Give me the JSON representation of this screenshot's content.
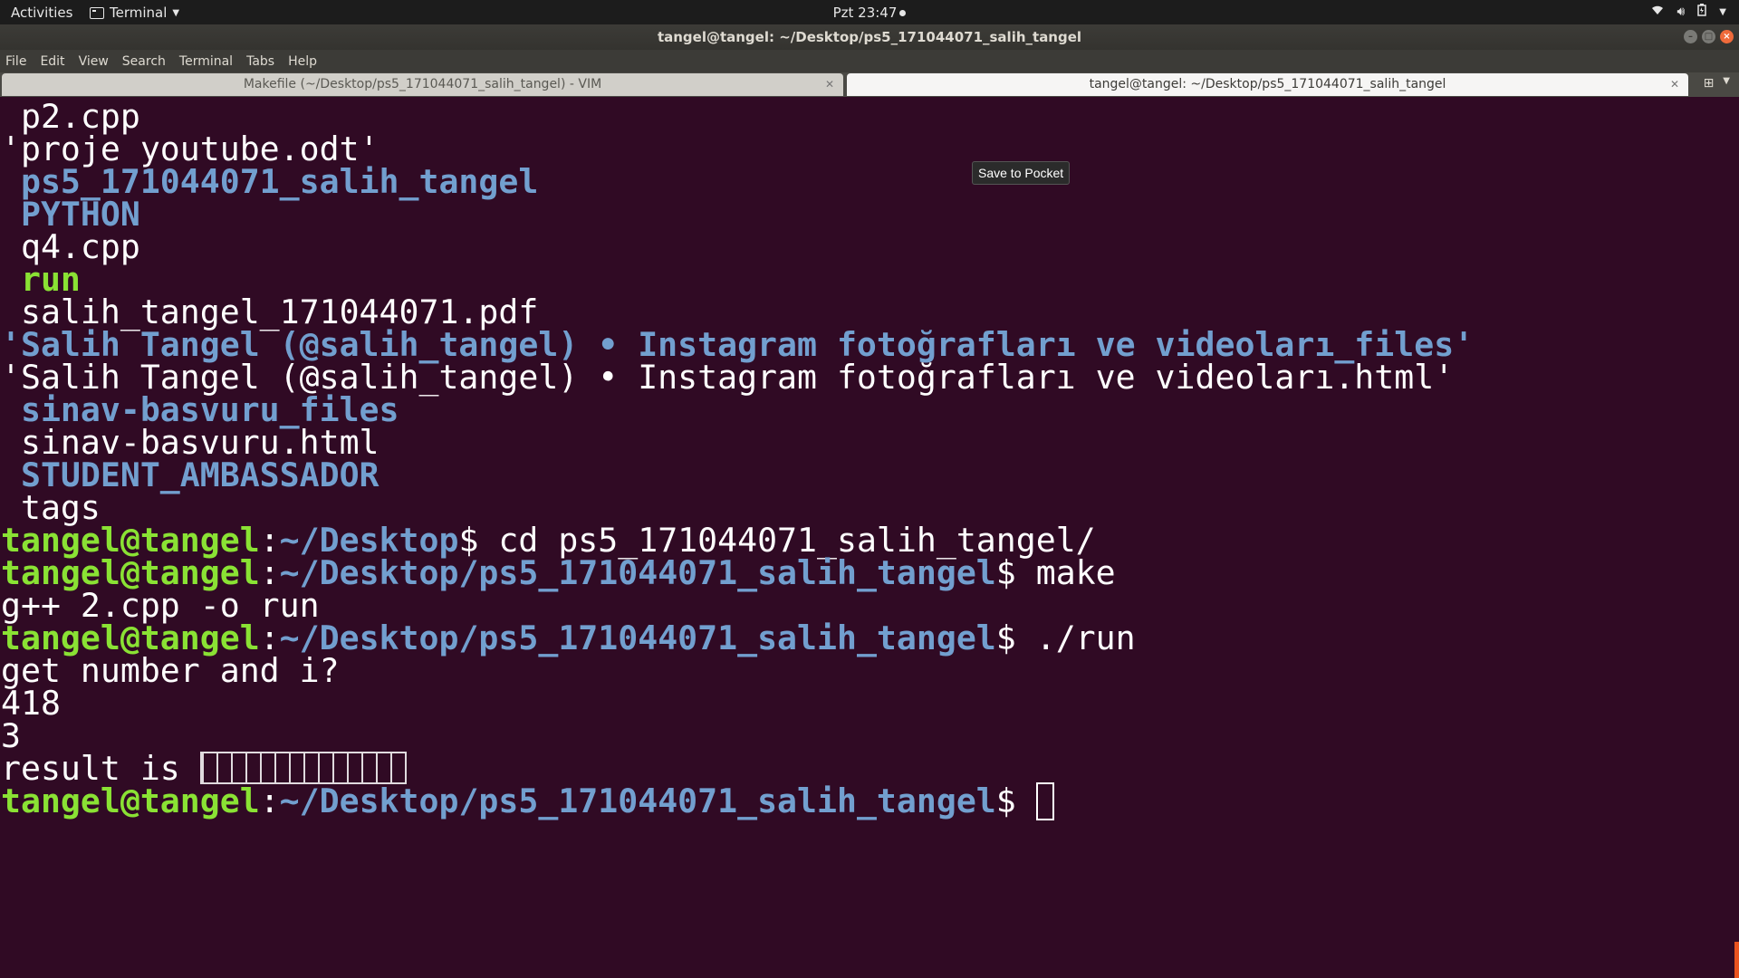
{
  "topbar": {
    "activities": "Activities",
    "app_menu": "Terminal",
    "clock": "Pzt 23:47"
  },
  "window": {
    "title": "tangel@tangel: ~/Desktop/ps5_171044071_salih_tangel"
  },
  "menubar": {
    "items": [
      "File",
      "Edit",
      "View",
      "Search",
      "Terminal",
      "Tabs",
      "Help"
    ]
  },
  "tabs": [
    {
      "label": "Makefile (~/Desktop/ps5_171044071_salih_tangel) - VIM",
      "active": false
    },
    {
      "label": "tangel@tangel: ~/Desktop/ps5_171044071_salih_tangel",
      "active": true
    }
  ],
  "tooltip": "Save to Pocket",
  "terminal": {
    "listing": [
      " p2.cpp",
      "'proje youtube.odt'",
      " ps5_171044071_salih_tangel",
      " PYTHON",
      " q4.cpp",
      " run",
      " salih_tangel_171044071.pdf",
      "'Salih Tangel (@salih_tangel) • Instagram fotoğrafları ve videoları_files'",
      "'Salih Tangel (@salih_tangel) • Instagram fotoğrafları ve videoları.html'",
      " sinav-basvuru_files",
      " sinav-basvuru.html",
      " STUDENT_AMBASSADOR",
      " tags"
    ],
    "prompt_user": "tangel@tangel",
    "prompt_colon": ":",
    "path_desktop": "~/Desktop",
    "path_project": "~/Desktop/ps5_171044071_salih_tangel",
    "prompt_symbol": "$ ",
    "cmd_cd": "cd ps5_171044071_salih_tangel/",
    "cmd_make": "make",
    "make_output": "g++ 2.cpp -o run",
    "cmd_run": "./run",
    "program_prompt": "get number and i?",
    "input_number": "418",
    "input_i": "3",
    "result_label": "result is "
  }
}
